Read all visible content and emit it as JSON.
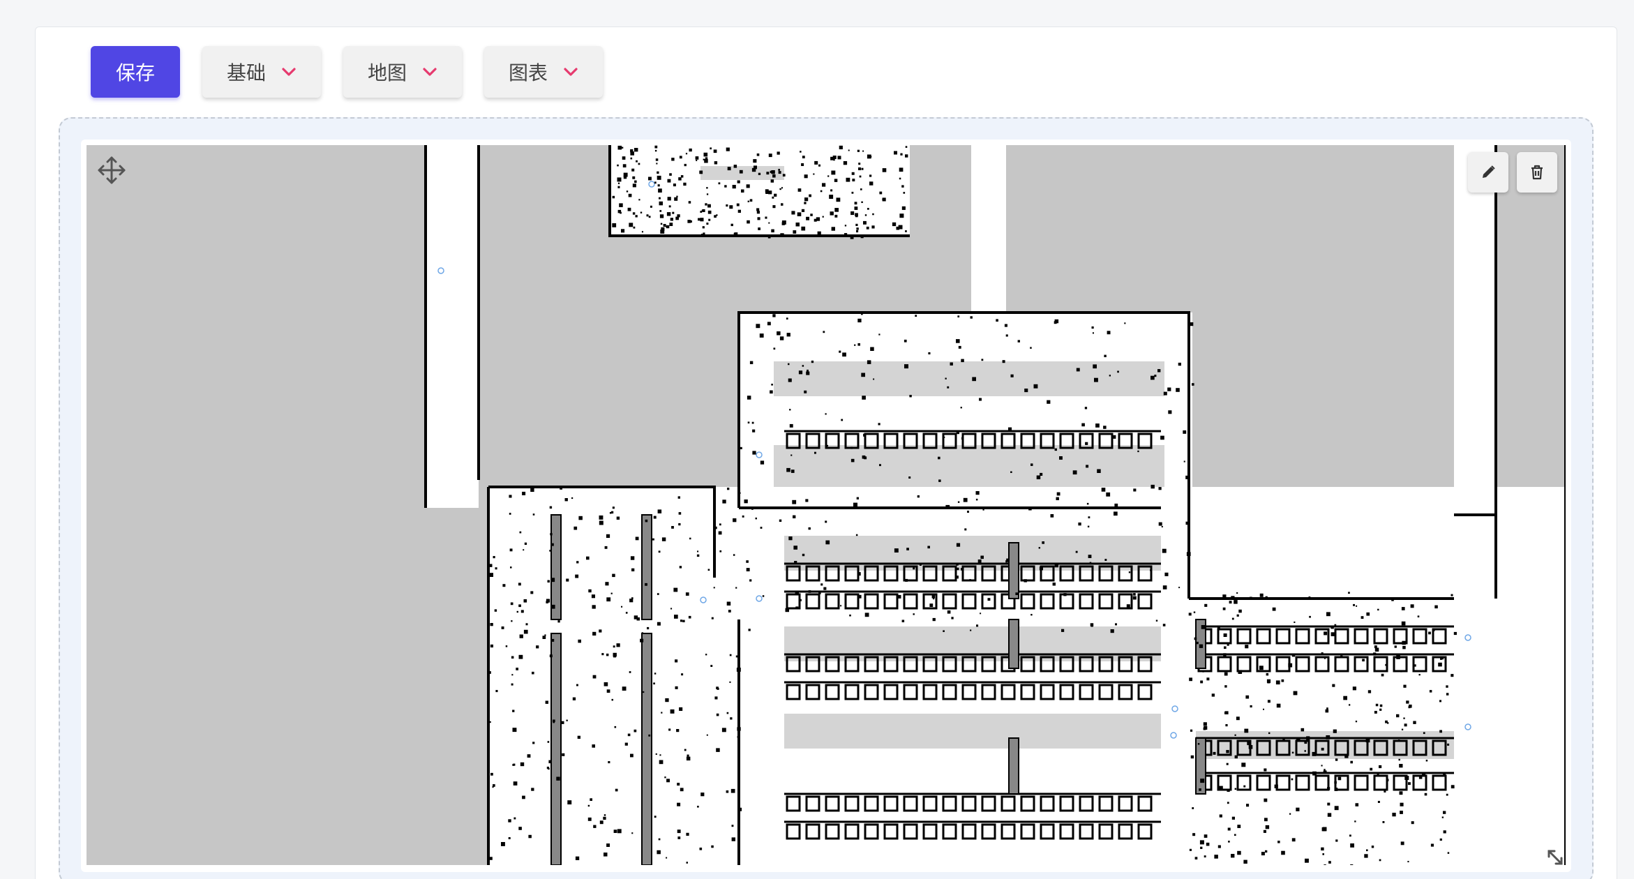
{
  "toolbar": {
    "save_label": "保存",
    "basic_label": "基础",
    "map_label": "地图",
    "chart_label": "图表"
  },
  "icons": {
    "move": "move-arrows-icon",
    "edit": "pencil-icon",
    "delete": "trash-icon",
    "resize": "resize-corner-icon",
    "dropdown": "chevron-down-icon"
  },
  "colors": {
    "primary": "#5046e4",
    "chevron": "#e63a6e",
    "map_unknown": "#c6c6c6",
    "map_free": "#ffffff",
    "map_obstacle": "#000000"
  }
}
